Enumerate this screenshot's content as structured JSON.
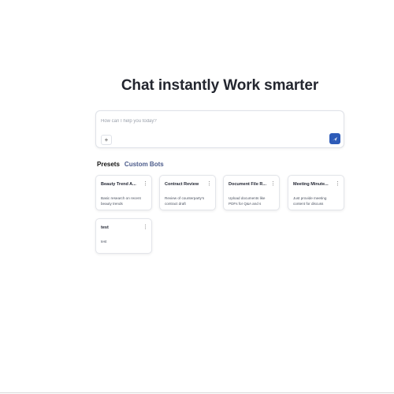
{
  "hero": {
    "title": "Chat instantly Work smarter"
  },
  "composer": {
    "placeholder": "How can I help you today?",
    "value": "",
    "add_label": "+"
  },
  "tabs": [
    {
      "label": "Presets",
      "active": true
    },
    {
      "label": "Custom Bots",
      "active": false
    }
  ],
  "cards": [
    {
      "title": "Beauty Trend A...",
      "desc_line1": "Basic research on recent",
      "desc_line2": "beauty trends"
    },
    {
      "title": "Contract Review",
      "desc_line1": "Review of counterparty's",
      "desc_line2": "contract draft"
    },
    {
      "title": "Document File R...",
      "desc_line1": "Upload documents like",
      "desc_line2": "PDFs for Q&A and s"
    },
    {
      "title": "Meeting Minute...",
      "desc_line1": "Just provide meeting",
      "desc_line2": "content for discuss"
    },
    {
      "title": "test",
      "desc_line1": "test",
      "desc_line2": ""
    }
  ],
  "colors": {
    "accent": "#2d5bb8",
    "tab_inactive": "#4a5a8a"
  },
  "icons": {
    "add": "plus-icon",
    "send": "send-arrow-icon",
    "card_menu": "vertical-ellipsis-icon"
  }
}
